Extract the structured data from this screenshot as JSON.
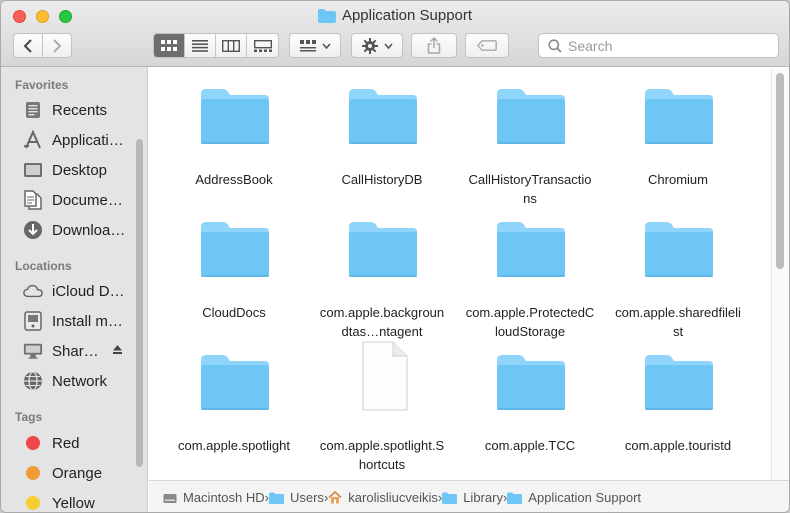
{
  "window": {
    "title": "Application Support"
  },
  "toolbar": {
    "search_placeholder": "Search",
    "view_modes": [
      "icon-view",
      "list-view",
      "column-view",
      "gallery-view"
    ],
    "active_view": "icon-view"
  },
  "sidebar": {
    "sections": [
      {
        "heading": "Favorites",
        "items": [
          {
            "label": "Recents",
            "icon": "recents-icon"
          },
          {
            "label": "Applicati…",
            "icon": "applications-icon"
          },
          {
            "label": "Desktop",
            "icon": "desktop-icon"
          },
          {
            "label": "Docume…",
            "icon": "documents-icon"
          },
          {
            "label": "Downloa…",
            "icon": "downloads-icon"
          }
        ]
      },
      {
        "heading": "Locations",
        "items": [
          {
            "label": "iCloud D…",
            "icon": "icloud-icon"
          },
          {
            "label": "Install m…",
            "icon": "disk-icon"
          },
          {
            "label": "Shar…",
            "icon": "shared-computer-icon"
          },
          {
            "label": "Network",
            "icon": "network-icon"
          }
        ]
      },
      {
        "heading": "Tags",
        "items": [
          {
            "label": "Red",
            "color": "#f0474b"
          },
          {
            "label": "Orange",
            "color": "#f19a38"
          },
          {
            "label": "Yellow",
            "color": "#f7cf33"
          }
        ]
      }
    ]
  },
  "files": [
    {
      "name": "AddressBook",
      "type": "folder"
    },
    {
      "name": "CallHistoryDB",
      "type": "folder"
    },
    {
      "name": "CallHistoryTransactions",
      "type": "folder"
    },
    {
      "name": "Chromium",
      "type": "folder"
    },
    {
      "name": "CloudDocs",
      "type": "folder"
    },
    {
      "name": "com.apple.backgroundtas…ntagent",
      "type": "folder"
    },
    {
      "name": "com.apple.ProtectedCloudStorage",
      "type": "folder"
    },
    {
      "name": "com.apple.sharedfilelist",
      "type": "folder"
    },
    {
      "name": "com.apple.spotlight",
      "type": "folder"
    },
    {
      "name": "com.apple.spotlight.Shortcuts",
      "type": "file"
    },
    {
      "name": "com.apple.TCC",
      "type": "folder"
    },
    {
      "name": "com.apple.touristd",
      "type": "folder"
    }
  ],
  "pathbar": [
    {
      "label": "Macintosh HD",
      "icon": "hard-drive-icon"
    },
    {
      "label": "Users",
      "icon": "folder-icon"
    },
    {
      "label": "karolisliucveikis",
      "icon": "home-icon"
    },
    {
      "label": "Library",
      "icon": "folder-icon"
    },
    {
      "label": "Application Support",
      "icon": "folder-icon"
    }
  ],
  "colors": {
    "folder": "#6ec6f6",
    "folder_tab": "#8fd4fa",
    "selection_dark": "#6d6d6d"
  }
}
